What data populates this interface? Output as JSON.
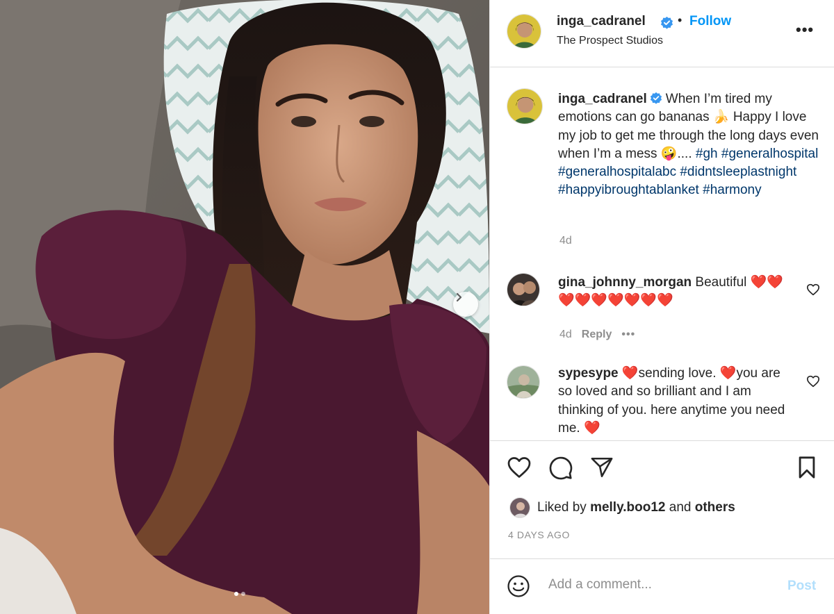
{
  "post": {
    "username": "inga_cadranel",
    "follow_label": "Follow",
    "separator": "•",
    "location": "The Prospect Studios",
    "more_label": "•••",
    "caption": {
      "username": "inga_cadranel",
      "text": "When I’m tired my emotions can go bananas 🍌 Happy I love my job to get me through the long days even when I’m a mess 🤪....",
      "hashtags": [
        "#gh",
        "#generalhospital",
        "#generalhospitalabc",
        "#didntsleeplastnight",
        "#happyibroughtablanket",
        "#harmony"
      ],
      "time": "4d"
    },
    "comments": [
      {
        "username": "gina_johnny_morgan",
        "text": "Beautiful ❤️❤️❤️❤️❤️❤️❤️❤️❤️",
        "time": "4d",
        "reply_label": "Reply",
        "more_label": "•••"
      },
      {
        "username": "sypesype",
        "text": "❤️sending love. ❤️you are so loved and so brilliant and I am thinking of you. here anytime you need me. ❤️"
      }
    ],
    "likes": {
      "prefix": "Liked by",
      "user": "melly.boo12",
      "conj": "and",
      "others": "others"
    },
    "date": "4 DAYS AGO",
    "comment_input_placeholder": "Add a comment...",
    "post_label": "Post"
  },
  "carousel": {
    "current": 1,
    "total": 2
  },
  "colors": {
    "link": "#0095f6",
    "hashtag": "#00376b",
    "muted": "#8e8e8e",
    "heart": "#ed4956",
    "verified": "#3897f0",
    "post_disabled": "#b2dffc"
  },
  "icons": [
    "verified-badge-icon",
    "more-options-icon",
    "heart-icon",
    "comment-icon",
    "share-icon",
    "bookmark-icon",
    "emoji-icon",
    "chevron-right-icon"
  ]
}
